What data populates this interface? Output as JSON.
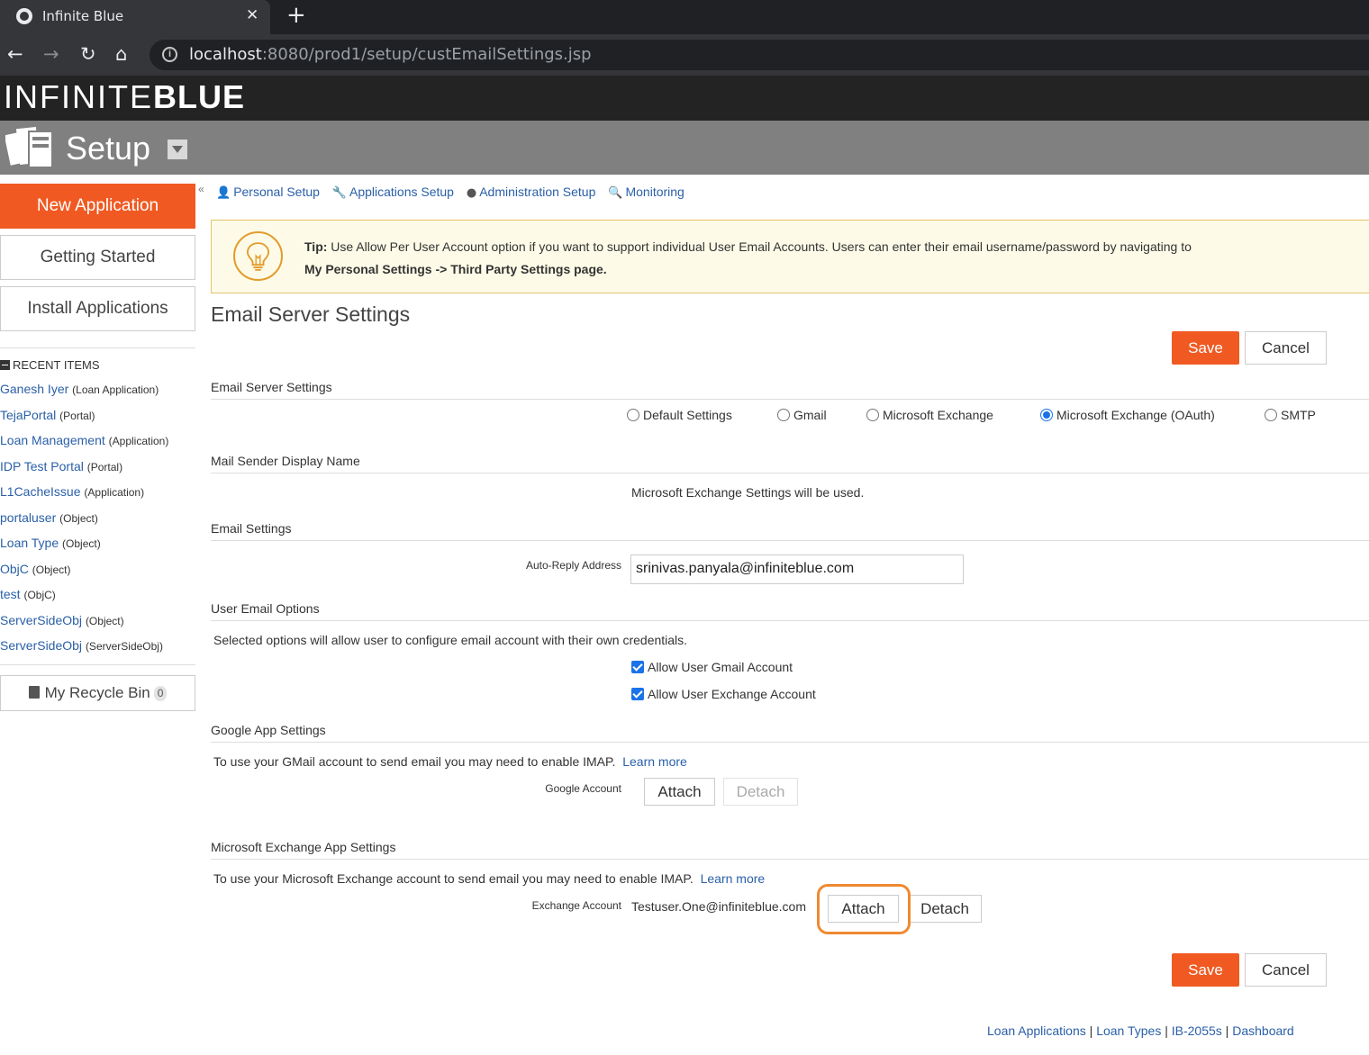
{
  "browser": {
    "tab_title": "Infinite Blue",
    "url_host": "localhost",
    "url_path": ":8080/prod1/setup/custEmailSettings.jsp"
  },
  "brand": {
    "logo_left": "INFINITE",
    "logo_right": "BLUE"
  },
  "header": {
    "title": "Setup"
  },
  "sidebar": {
    "new_app": "New Application",
    "getting_started": "Getting Started",
    "install_apps": "Install Applications",
    "recent_header": "RECENT ITEMS",
    "recent": [
      {
        "name": "Ganesh Iyer",
        "type": "(Loan Application)"
      },
      {
        "name": "TejaPortal",
        "type": "(Portal)"
      },
      {
        "name": "Loan Management",
        "type": "(Application)"
      },
      {
        "name": "IDP Test Portal",
        "type": "(Portal)"
      },
      {
        "name": "L1CacheIssue",
        "type": "(Application)"
      },
      {
        "name": "portaluser",
        "type": "(Object)"
      },
      {
        "name": "Loan Type",
        "type": "(Object)"
      },
      {
        "name": "ObjC",
        "type": "(Object)"
      },
      {
        "name": "test",
        "type": "(ObjC)"
      },
      {
        "name": "ServerSideObj",
        "type": "(Object)"
      },
      {
        "name": "ServerSideObj",
        "type": "(ServerSideObj)"
      }
    ],
    "recycle_bin": "My Recycle Bin",
    "recycle_count": "0"
  },
  "topnav": {
    "personal": "Personal Setup",
    "applications": "Applications Setup",
    "administration": "Administration Setup",
    "monitoring": "Monitoring"
  },
  "tip": {
    "label": "Tip:",
    "line1": " Use Allow Per User Account option if you want to support individual User Email Accounts. Users can enter their email username/password by navigating to",
    "line2": "My Personal Settings -> Third Party Settings page."
  },
  "page": {
    "title": "Email Server Settings",
    "save": "Save",
    "cancel": "Cancel"
  },
  "server": {
    "header": "Email Server Settings",
    "options": [
      "Default Settings",
      "Gmail",
      "Microsoft Exchange",
      "Microsoft Exchange (OAuth)",
      "SMTP"
    ],
    "selected": "Microsoft Exchange (OAuth)"
  },
  "sender": {
    "header": "Mail Sender Display Name",
    "note": "Microsoft Exchange Settings will be used."
  },
  "email": {
    "header": "Email Settings",
    "auto_reply_label": "Auto-Reply Address",
    "auto_reply_value": "srinivas.panyala@infiniteblue.com"
  },
  "user_options": {
    "header": "User Email Options",
    "desc": "Selected options will allow user to configure email account with their own credentials.",
    "gmail": "Allow User Gmail Account",
    "gmail_checked": true,
    "exchange": "Allow User Exchange Account",
    "exchange_checked": true
  },
  "google": {
    "header": "Google App Settings",
    "desc": "To use your GMail account to send email you may need to enable IMAP.",
    "learn_more": "Learn more",
    "account_label": "Google Account",
    "attach": "Attach",
    "detach": "Detach"
  },
  "exchange": {
    "header": "Microsoft Exchange App Settings",
    "desc": "To use your Microsoft Exchange account to send email you may need to enable IMAP.",
    "learn_more": "Learn more",
    "account_label": "Exchange Account",
    "account_value": "Testuser.One@infiniteblue.com",
    "attach": "Attach",
    "detach": "Detach"
  },
  "footer": {
    "links": [
      "Loan Applications",
      "Loan Types",
      "IB-2055s",
      "Dashboard"
    ],
    "separator": " | "
  },
  "colors": {
    "accent": "#f05a22",
    "link": "#2a5fa8",
    "highlight": "#ef8a30"
  }
}
